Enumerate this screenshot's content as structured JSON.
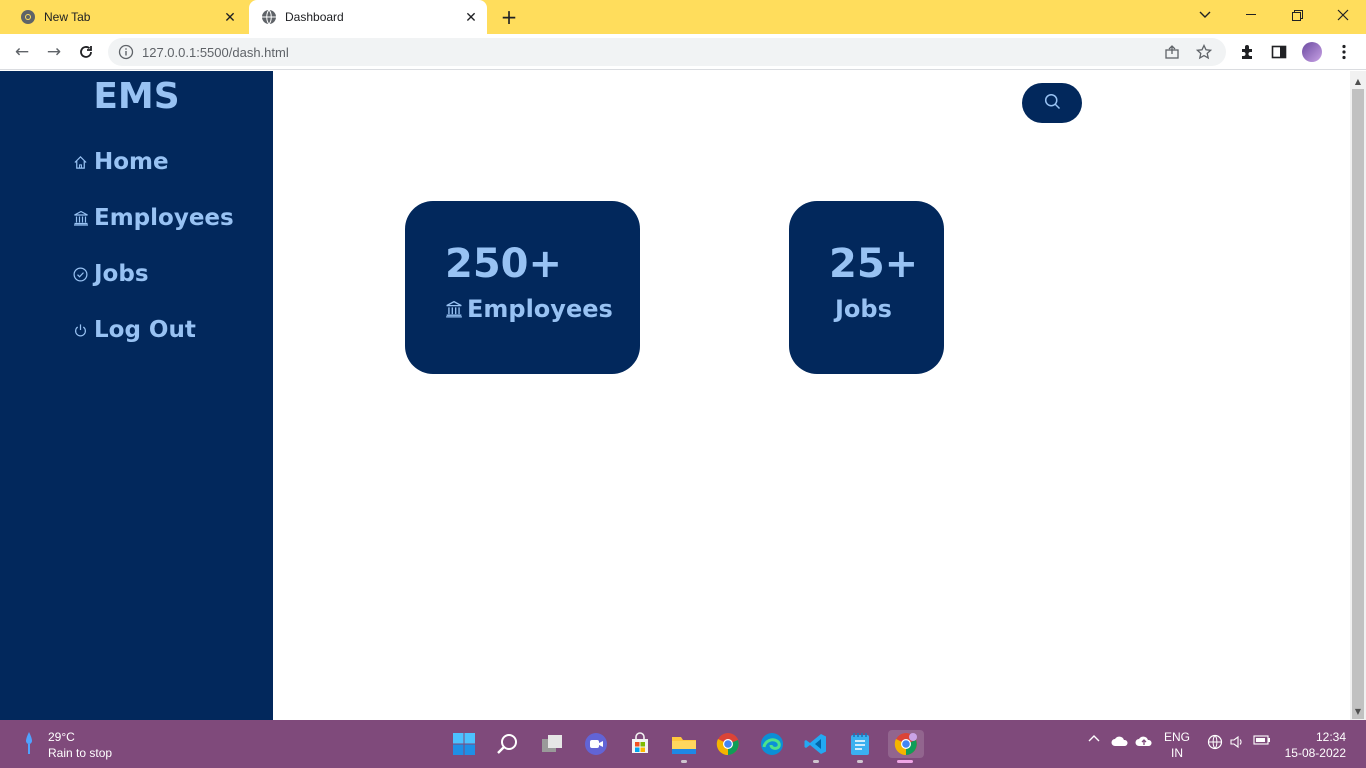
{
  "browser": {
    "tabs": [
      {
        "title": "New Tab",
        "active": false
      },
      {
        "title": "Dashboard",
        "active": true
      }
    ],
    "url": "127.0.0.1:5500/dash.html",
    "tabbar_color": "#ffdd5c"
  },
  "sidebar": {
    "brand": "EMS",
    "items": [
      {
        "label": "Home",
        "icon": "home-icon"
      },
      {
        "label": "Employees",
        "icon": "bank-icon"
      },
      {
        "label": "Jobs",
        "icon": "check-circle-icon"
      },
      {
        "label": "Log Out",
        "icon": "power-icon"
      }
    ],
    "bg_color": "#02285c",
    "text_color": "#98c2f3"
  },
  "main": {
    "search_icon": "search-icon",
    "cards": [
      {
        "value": "250+",
        "label": "Employees",
        "icon": "bank-icon"
      },
      {
        "value": "25+",
        "label": "Jobs"
      }
    ]
  },
  "taskbar": {
    "weather": {
      "temp": "29°C",
      "desc": "Rain to stop"
    },
    "lang": {
      "line1": "ENG",
      "line2": "IN"
    },
    "time": "12:34",
    "date": "15-08-2022",
    "bg_color": "#7f4a7b"
  }
}
